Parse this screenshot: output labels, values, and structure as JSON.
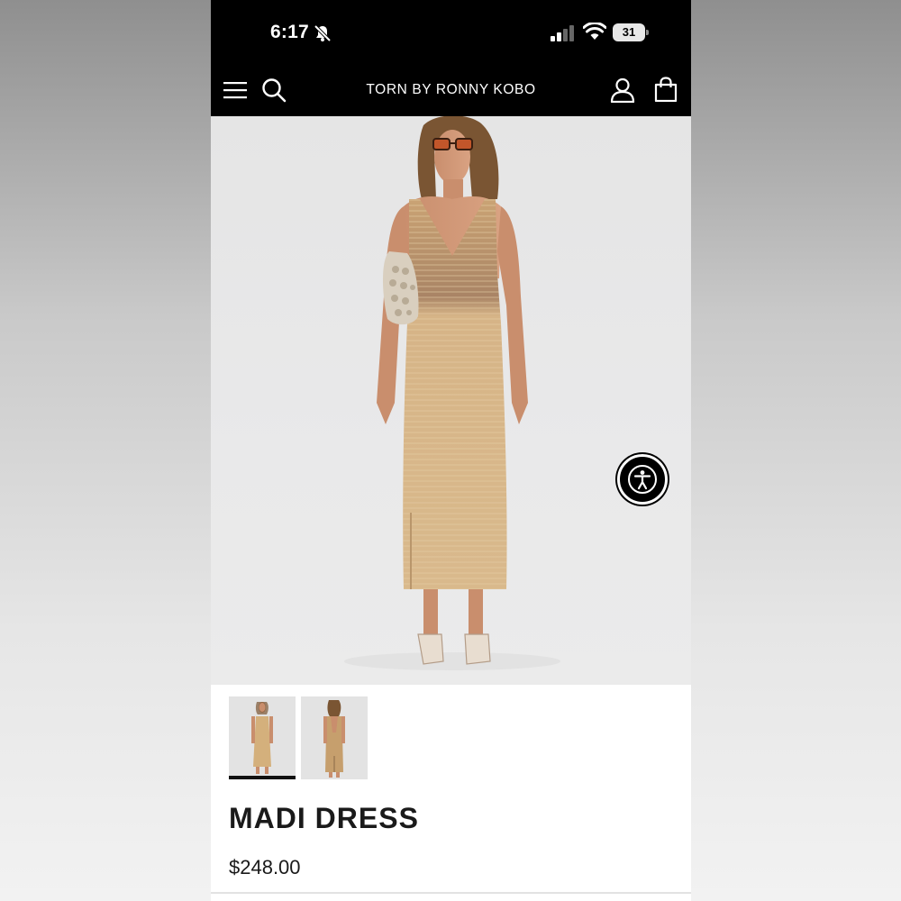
{
  "status_bar": {
    "time": "6:17",
    "battery": "31",
    "icons": [
      "mute-icon",
      "signal-icon",
      "wifi-icon",
      "battery-icon"
    ]
  },
  "header": {
    "brand": "TORN BY RONNY KOBO",
    "icons": [
      "menu-icon",
      "search-icon",
      "account-icon",
      "bag-icon"
    ]
  },
  "product": {
    "name": "MADI DRESS",
    "price": "$248.00",
    "thumbnails": [
      "front",
      "back"
    ],
    "selected_thumbnail": 0
  },
  "colors": {
    "header_bg": "#000000",
    "dress": "#d4b07c",
    "background": "#e8e8e8"
  }
}
